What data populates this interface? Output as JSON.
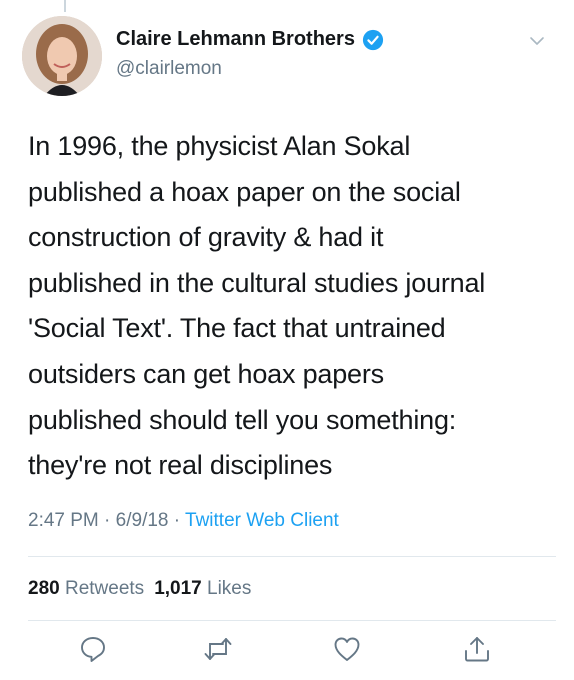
{
  "tweet": {
    "display_name": "Claire Lehmann Brothers",
    "handle": "@clairlemon",
    "text": "In 1996, the physicist Alan Sokal\npublished a hoax paper on the social\nconstruction of gravity & had it\npublished in the cultural studies journal\n'Social Text'. The fact that untrained\noutsiders can get hoax papers\npublished should tell you something:\nthey're not real disciplines",
    "time": "2:47 PM",
    "date": "6/9/18",
    "separator": "·",
    "client": "Twitter Web Client"
  },
  "stats": {
    "retweets_count": "280",
    "retweets_label": "Retweets",
    "likes_count": "1,017",
    "likes_label": "Likes"
  },
  "icons": {
    "verified": "verified-badge-icon",
    "menu": "chevron-down-icon",
    "reply": "reply-icon",
    "retweet": "retweet-icon",
    "like": "heart-icon",
    "share": "share-icon"
  },
  "colors": {
    "accent": "#1da1f2",
    "secondary_text": "#657786",
    "primary_text": "#14171a",
    "divider": "#e1e8ed"
  }
}
